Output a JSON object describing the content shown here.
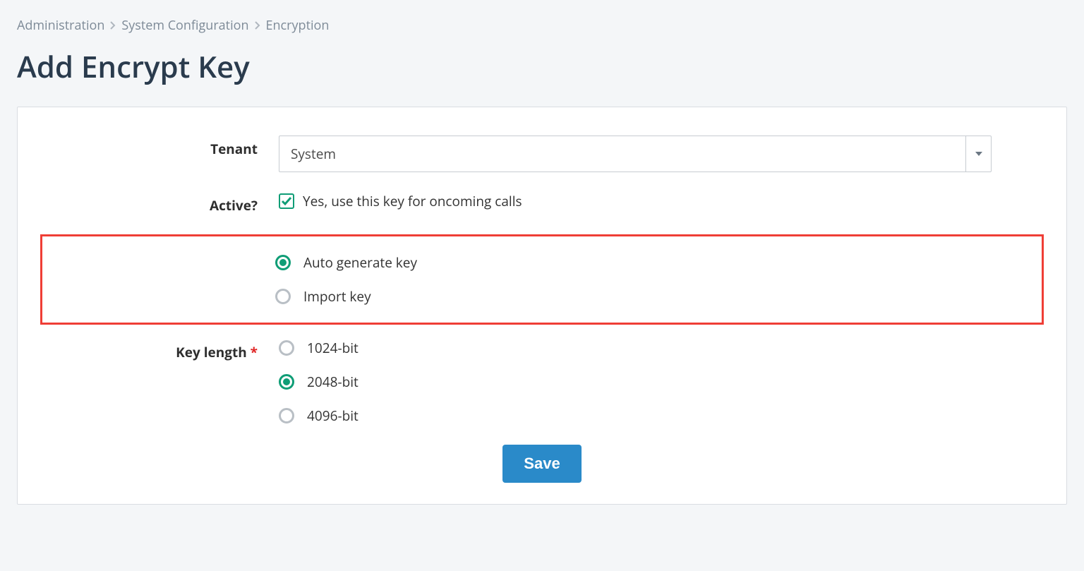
{
  "breadcrumb": {
    "items": [
      "Administration",
      "System Configuration",
      "Encryption"
    ]
  },
  "title": "Add Encrypt Key",
  "form": {
    "tenant": {
      "label": "Tenant",
      "value": "System"
    },
    "active": {
      "label": "Active?",
      "checked": true,
      "text": "Yes, use this key for oncoming calls"
    },
    "key_source": {
      "options": [
        {
          "label": "Auto generate key",
          "checked": true
        },
        {
          "label": "Import key",
          "checked": false
        }
      ]
    },
    "key_length": {
      "label": "Key length",
      "required_mark": "*",
      "options": [
        {
          "label": "1024-bit",
          "checked": false
        },
        {
          "label": "2048-bit",
          "checked": true
        },
        {
          "label": "4096-bit",
          "checked": false
        }
      ]
    },
    "save_label": "Save"
  }
}
